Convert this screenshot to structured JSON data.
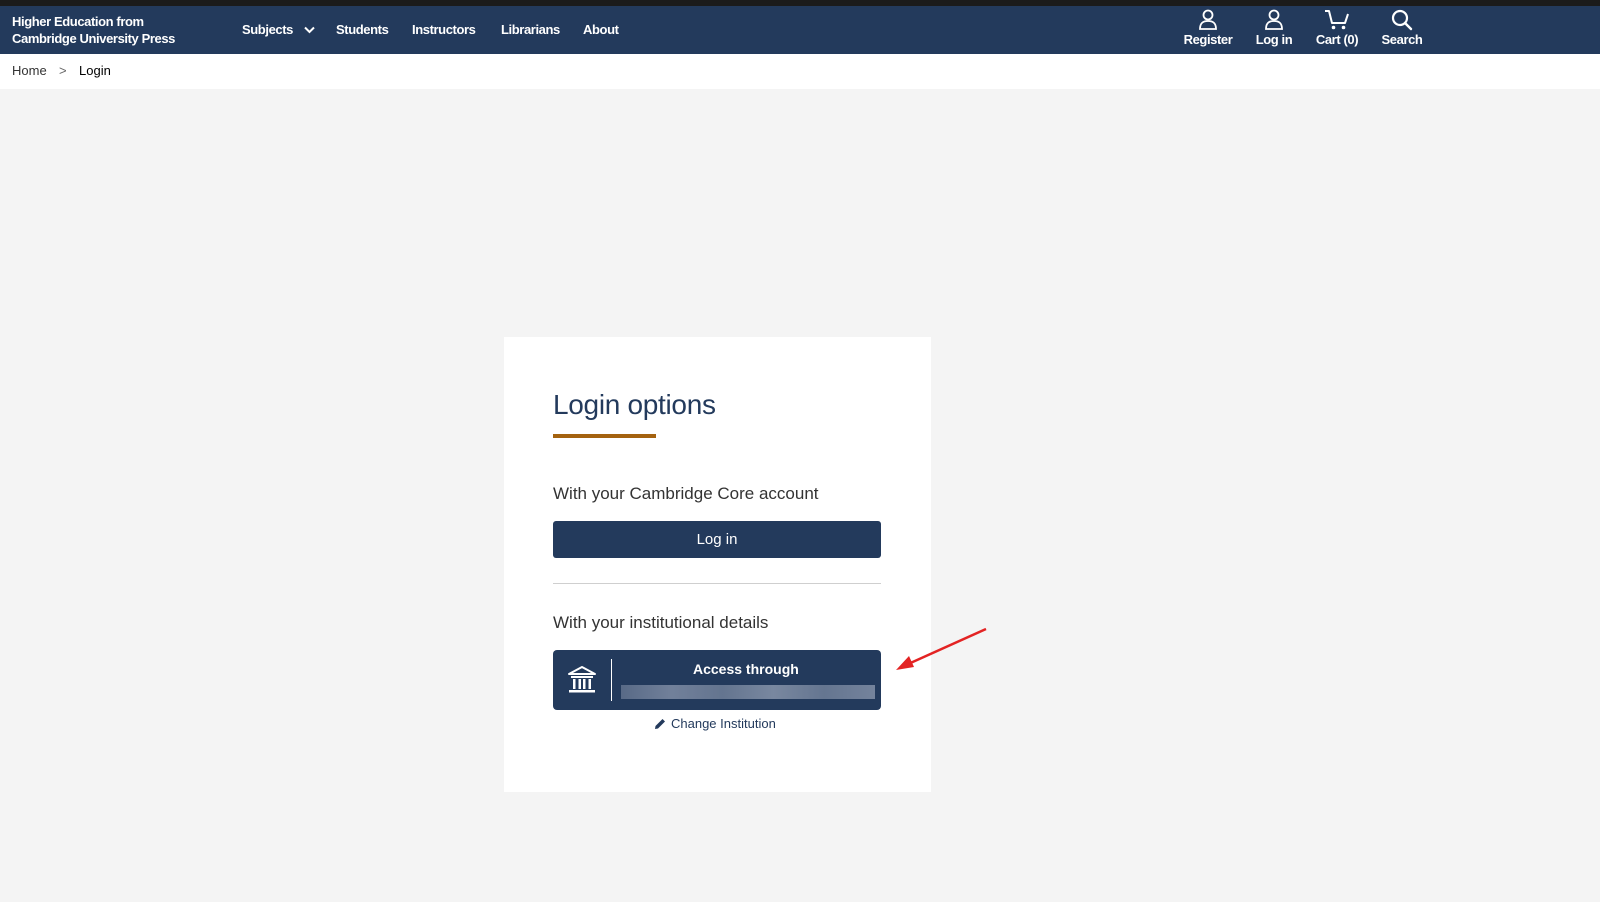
{
  "header": {
    "brand_line1": "Higher Education from",
    "brand_line2": "Cambridge University Press",
    "nav": {
      "subjects": "Subjects",
      "students": "Students",
      "instructors": "Instructors",
      "librarians": "Librarians",
      "about": "About"
    },
    "util": {
      "register": "Register",
      "login": "Log in",
      "cart": "Cart (0)",
      "search": "Search"
    }
  },
  "breadcrumb": {
    "home": "Home",
    "separator": ">",
    "current": "Login"
  },
  "card": {
    "title": "Login options",
    "core_heading": "With your Cambridge Core account",
    "login_button": "Log in",
    "institution_heading": "With your institutional details",
    "access_through": "Access through",
    "change_institution": "Change Institution"
  },
  "colors": {
    "header_bg": "#233a5c",
    "accent_underline": "#a4620f",
    "annotation_arrow": "#e32323"
  }
}
